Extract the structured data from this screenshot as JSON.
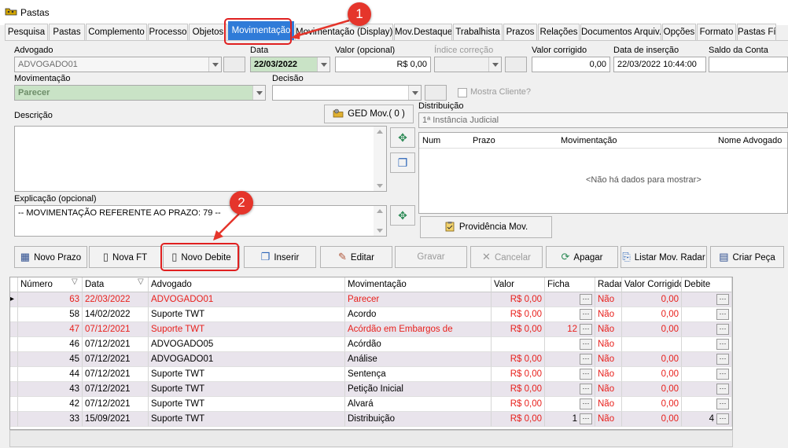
{
  "window": {
    "title": "Pastas"
  },
  "tabs": [
    "Pesquisa",
    "Pastas",
    "Complemento",
    "Processo",
    "Objetos",
    "Movimentação",
    "Movimentação (Display)",
    "Mov.Destaque",
    "Trabalhista",
    "Prazos",
    "Relações",
    "Documentos Arquiv.",
    "Opções",
    "Formato",
    "Pastas Físi"
  ],
  "active_tab": "Movimentação",
  "form": {
    "advogado_label": "Advogado",
    "advogado_value": "ADVOGADO01",
    "data_label": "Data",
    "data_value": "22/03/2022",
    "valor_label": "Valor (opcional)",
    "valor_value": "R$ 0,00",
    "indice_label": "Índice correção",
    "valor_corrigido_label": "Valor corrigido",
    "valor_corrigido_value": "0,00",
    "data_insercao_label": "Data de inserção",
    "data_insercao_value": "22/03/2022 10:44:00",
    "saldo_label": "Saldo da Conta",
    "movimentacao_label": "Movimentação",
    "movimentacao_value": "Parecer",
    "decisao_label": "Decisão",
    "mostra_cliente_label": "Mostra Cliente?",
    "descricao_label": "Descrição",
    "ged_button": "GED Mov.( 0 )",
    "distribuicao_label": "Distribuição",
    "distribuicao_value": "1ª Instância Judicial",
    "explicacao_label": "Explicação (opcional)",
    "explicacao_value": "-- MOVIMENTAÇÃO REFERENTE AO PRAZO: 79 --",
    "providencia_button": "Providência Mov."
  },
  "distrib_grid": {
    "columns": [
      "Num",
      "Prazo",
      "Movimentação",
      "Nome Advogado"
    ],
    "empty_text": "<Não há dados para mostrar>"
  },
  "toolbar": [
    "Novo Prazo",
    "Nova FT",
    "Novo Debite",
    "Inserir",
    "Editar",
    "Gravar",
    "Cancelar",
    "Apagar",
    "Listar Mov. Radar",
    "Criar Peça"
  ],
  "annotations": {
    "badge1": "1",
    "badge2": "2"
  },
  "grid": {
    "columns": [
      "Número",
      "Data",
      "Advogado",
      "Movimentação",
      "Valor",
      "Ficha",
      "Radar",
      "Valor Corrigido",
      "Debite"
    ],
    "rows": [
      {
        "numero": "63",
        "data": "22/03/2022",
        "advogado": "ADVOGADO01",
        "mov": "Parecer",
        "valor": "R$ 0,00",
        "ficha": "",
        "radar": "Não",
        "corrigido": "0,00",
        "debite": "",
        "red": true
      },
      {
        "numero": "58",
        "data": "14/02/2022",
        "advogado": "Suporte TWT",
        "mov": "Acordo",
        "valor": "R$ 0,00",
        "ficha": "",
        "radar": "Não",
        "corrigido": "0,00",
        "debite": "",
        "red": false
      },
      {
        "numero": "47",
        "data": "07/12/2021",
        "advogado": "Suporte TWT",
        "mov": "Acórdão em Embargos de",
        "valor": "R$ 0,00",
        "ficha": "12",
        "radar": "Não",
        "corrigido": "0,00",
        "debite": "",
        "red": true
      },
      {
        "numero": "46",
        "data": "07/12/2021",
        "advogado": "ADVOGADO05",
        "mov": "Acórdão",
        "valor": "",
        "ficha": "",
        "radar": "Não",
        "corrigido": "",
        "debite": "",
        "red": false
      },
      {
        "numero": "45",
        "data": "07/12/2021",
        "advogado": "ADVOGADO01",
        "mov": "Análise",
        "valor": "R$ 0,00",
        "ficha": "",
        "radar": "Não",
        "corrigido": "0,00",
        "debite": "",
        "red": false
      },
      {
        "numero": "44",
        "data": "07/12/2021",
        "advogado": "Suporte TWT",
        "mov": "Sentença",
        "valor": "R$ 0,00",
        "ficha": "",
        "radar": "Não",
        "corrigido": "0,00",
        "debite": "",
        "red": false
      },
      {
        "numero": "43",
        "data": "07/12/2021",
        "advogado": "Suporte TWT",
        "mov": "Petição Inicial",
        "valor": "R$ 0,00",
        "ficha": "",
        "radar": "Não",
        "corrigido": "0,00",
        "debite": "",
        "red": false
      },
      {
        "numero": "42",
        "data": "07/12/2021",
        "advogado": "Suporte TWT",
        "mov": "Alvará",
        "valor": "R$ 0,00",
        "ficha": "",
        "radar": "Não",
        "corrigido": "0,00",
        "debite": "",
        "red": false
      },
      {
        "numero": "33",
        "data": "15/09/2021",
        "advogado": "Suporte TWT",
        "mov": "Distribuição",
        "valor": "R$ 0,00",
        "ficha": "1",
        "radar": "Não",
        "corrigido": "0,00",
        "debite": "4",
        "red": false
      }
    ]
  },
  "colors": {
    "accent": "#2f7bd8",
    "highlight_red": "#e8201c",
    "annotation_red": "#e5352b",
    "green_field": "#c9e3c6"
  }
}
